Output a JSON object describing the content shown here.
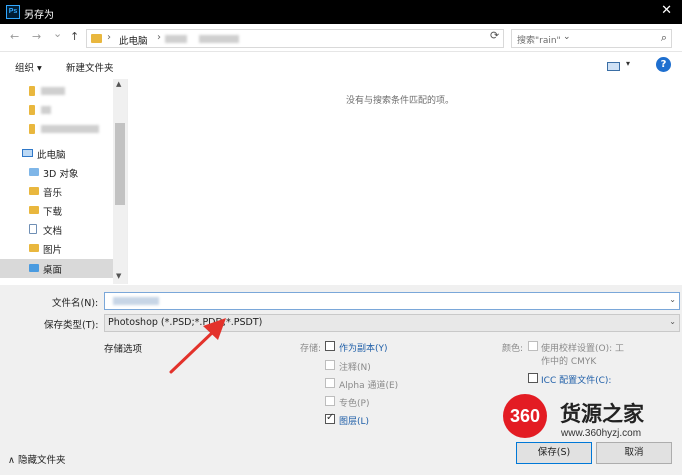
{
  "window": {
    "app_icon": "Ps",
    "title": "另存为",
    "close": "✕"
  },
  "nav": {
    "back": "←",
    "forward": "→",
    "recent": "⌄",
    "up": "↑",
    "breadcrumb_root": "此电脑",
    "breadcrumb_sep": "›",
    "address_dropdown": "⌄",
    "refresh": "⟳",
    "search_placeholder": "搜索\"rain\"",
    "search_glyph": "⌕"
  },
  "toolbar": {
    "organize": "组织 ▾",
    "new_folder": "新建文件夹",
    "view_dropdown": "▾",
    "help": "?"
  },
  "sidebar": {
    "this_pc": "此电脑",
    "items": [
      {
        "label": "3D 对象"
      },
      {
        "label": "音乐"
      },
      {
        "label": "下载"
      },
      {
        "label": "文档"
      },
      {
        "label": "图片"
      },
      {
        "label": "桌面"
      }
    ],
    "scroll_up": "▲",
    "scroll_down": "▼"
  },
  "content": {
    "empty_message": "没有与搜索条件匹配的项。"
  },
  "form": {
    "filename_label": "文件名(N):",
    "filename_value": "",
    "filename_dropdown": "⌄",
    "filetype_label": "保存类型(T):",
    "filetype_value": "Photoshop (*.PSD;*.PDD;*.PSDT)",
    "filetype_dropdown": "⌄"
  },
  "options": {
    "section_label": "存储选项",
    "save_label": "存储:",
    "check_mark": "✓",
    "as_copy": "作为副本(Y)",
    "notes": "注释(N)",
    "alpha": "Alpha 通道(E)",
    "spot": "专色(P)",
    "layers": "图层(L)",
    "color_label": "颜色:",
    "proof_line1": "使用校样设置(O): 工",
    "proof_line2": "作中的 CMYK",
    "icc_line1": "ICC 配置文件(C):"
  },
  "footer": {
    "hide_folders": "隐藏文件夹",
    "collapse_glyph": "∧",
    "save_button": "保存(S)",
    "cancel_button": "取消"
  },
  "watermark": {
    "logo_text": "360",
    "name": "货源之家",
    "url": "www.360hyzj.com"
  },
  "colors": {
    "accent": "#1e5ea8",
    "titlebar": "#000000",
    "annotation_arrow": "#e3322b",
    "watermark_red": "#e31c23"
  }
}
